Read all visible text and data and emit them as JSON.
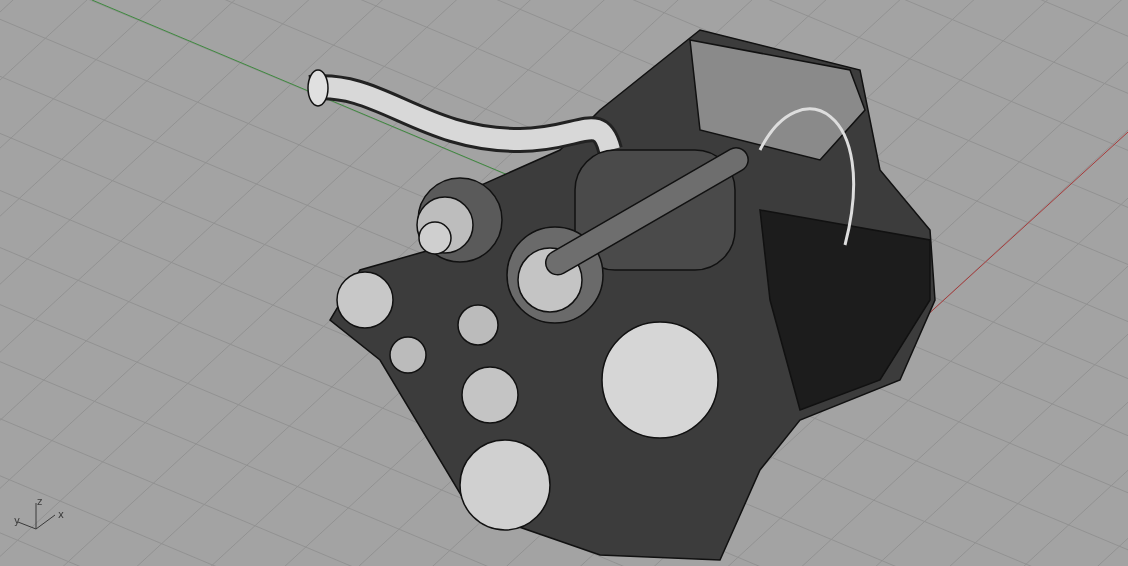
{
  "viewport": {
    "axes": [
      {
        "kind": "vertical",
        "label": "z"
      },
      {
        "kind": "depth",
        "label": "y"
      },
      {
        "kind": "horizontal",
        "label": "x"
      }
    ]
  }
}
